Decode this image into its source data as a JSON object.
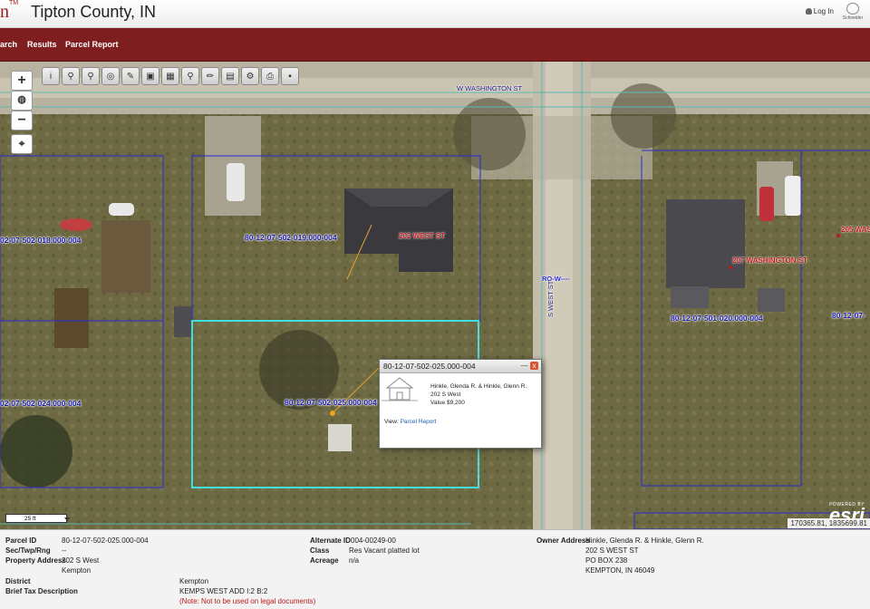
{
  "header": {
    "logo_fragment": "n",
    "logo_tm": "TM",
    "title": "Tipton County, IN",
    "login": "Log In",
    "brand": "Schneider"
  },
  "nav": {
    "items": [
      "arch",
      "Results",
      "Parcel Report"
    ]
  },
  "map": {
    "zoom_in": "+",
    "zoom_out": "−",
    "globe_icon": "globe-icon",
    "locate_icon": "crosshair-icon",
    "toolbar": [
      {
        "icon": "info-icon",
        "glyph": "i"
      },
      {
        "icon": "identify-icon",
        "glyph": "⚲"
      },
      {
        "icon": "select-icon",
        "glyph": "⚲"
      },
      {
        "icon": "buffer-icon",
        "glyph": "◎"
      },
      {
        "icon": "draw-icon",
        "glyph": "✎"
      },
      {
        "icon": "image-icon",
        "glyph": "▣"
      },
      {
        "icon": "measure-icon",
        "glyph": "▦"
      },
      {
        "icon": "search-icon",
        "glyph": "⚲"
      },
      {
        "icon": "pencil-icon",
        "glyph": "✏"
      },
      {
        "icon": "layers-icon",
        "glyph": "▤"
      },
      {
        "icon": "gear-icon",
        "glyph": "⚙"
      },
      {
        "icon": "print-icon",
        "glyph": "⎙"
      },
      {
        "icon": "save-icon",
        "glyph": "▪"
      }
    ],
    "parcels": [
      "02-07-502-018.000-004",
      "80-12-07-502-019.000-004",
      "80-12-07-501-020.000-004",
      "80-12-07-",
      "02-07-502-024.000-004",
      "80-12-07-502-025.000-004"
    ],
    "addresses": [
      "202 WEST ST",
      "207 WASHINGTON ST",
      "205 WAS"
    ],
    "streets": [
      "W WASHINGTON ST",
      "S WEST ST",
      "RO-W----"
    ],
    "scale": "25 ft",
    "coords": "170365.81, 1835699.81",
    "esri_powered": "POWERED BY",
    "esri_logo": "esri"
  },
  "popup": {
    "title": "80-12-07-502-025.000-004",
    "minimize": "—",
    "close": "x",
    "owner": "Hinkle, Glenda R. & Hinkle, Glenn R.",
    "address": "202 S West",
    "value": "Value $9,200",
    "view_label": "View:",
    "view_link": "Parcel Report"
  },
  "info": {
    "parcel_id_label": "Parcel ID",
    "parcel_id": "80-12-07-502-025.000-004",
    "sec_label": "Sec/Twp/Rng",
    "sec": "--",
    "property_address_label": "Property Address",
    "property_address_line1": "202 S West",
    "property_address_line2": "Kempton",
    "district_label": "District",
    "district": "Kempton",
    "brief_tax_label": "Brief Tax Description",
    "brief_tax": "KEMPS WEST ADD I:2 B:2",
    "brief_tax_note": "(Note: Not to be used on legal documents)",
    "alternate_id_label": "Alternate ID",
    "alternate_id": "004-00249-00",
    "class_label": "Class",
    "class": "Res Vacant platted lot",
    "acreage_label": "Acreage",
    "acreage": "n/a",
    "owner_address_label": "Owner Address",
    "owner_line1": "Hinkle, Glenda R. & Hinkle, Glenn R.",
    "owner_line2": "202 S WEST ST",
    "owner_line3": "PO BOX 238",
    "owner_line4": "KEMPTON, IN 46049"
  },
  "colors": {
    "nav": "#7f1e1e",
    "parcel_line": "#2a2ad8",
    "selected_parcel": "#40e0e0",
    "parcel_label": "#1a1aa8",
    "address_label": "#c01818"
  }
}
